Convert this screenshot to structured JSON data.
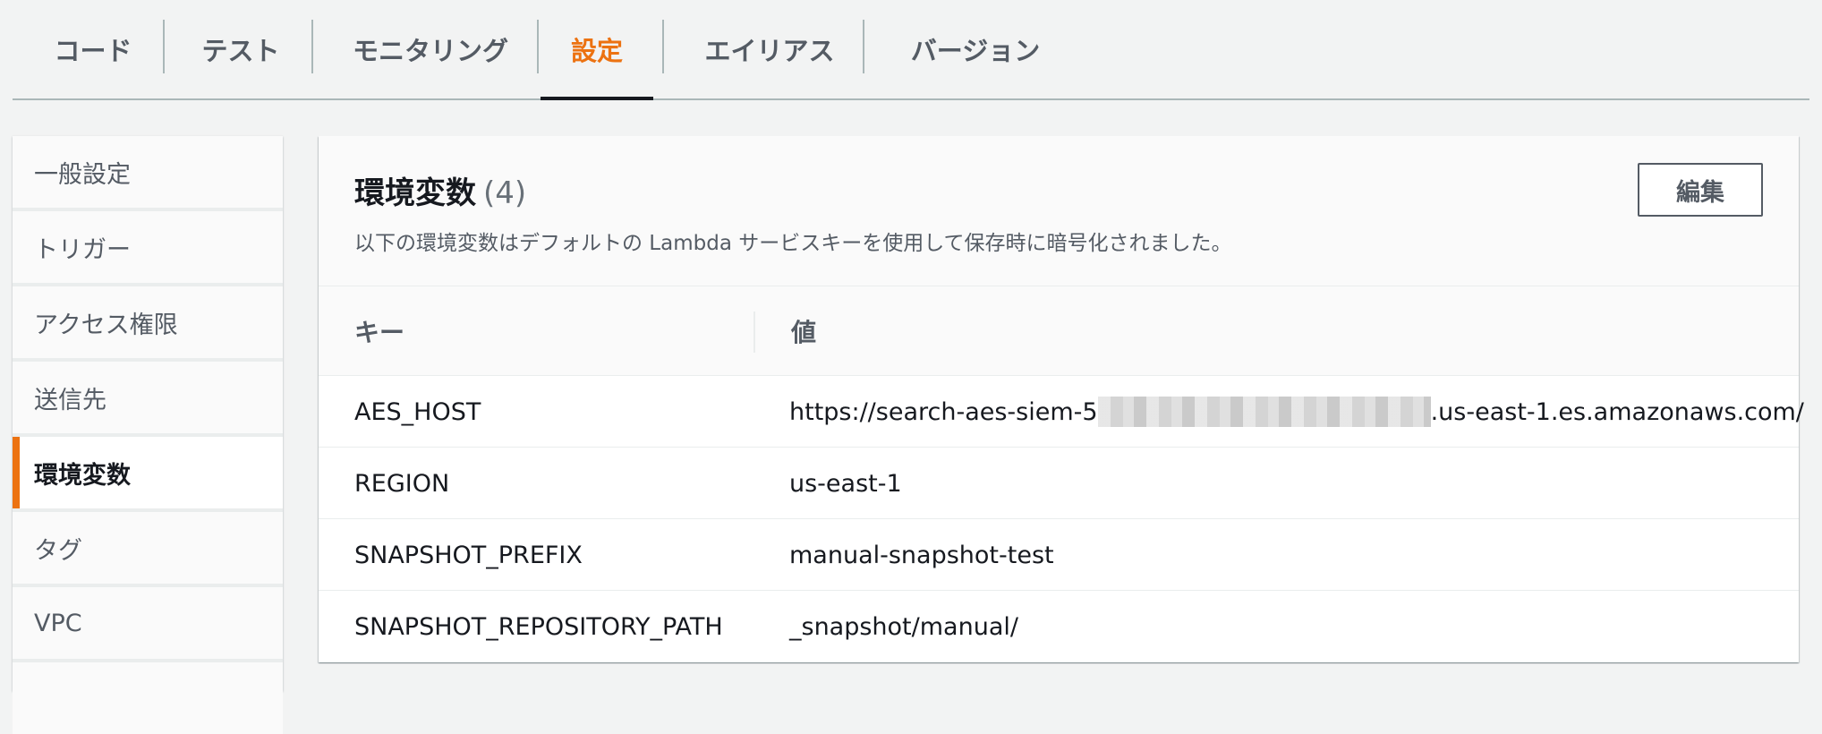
{
  "tabs": [
    {
      "label": "コード"
    },
    {
      "label": "テスト"
    },
    {
      "label": "モニタリング"
    },
    {
      "label": "設定"
    },
    {
      "label": "エイリアス"
    },
    {
      "label": "バージョン"
    }
  ],
  "sidebar": {
    "items": [
      {
        "label": "一般設定"
      },
      {
        "label": "トリガー"
      },
      {
        "label": "アクセス権限"
      },
      {
        "label": "送信先"
      },
      {
        "label": "環境変数"
      },
      {
        "label": "タグ"
      },
      {
        "label": "VPC"
      }
    ]
  },
  "panel": {
    "title": "環境変数",
    "count": "(4)",
    "description": "以下の環境変数はデフォルトの Lambda サービスキーを使用して保存時に暗号化されました。",
    "edit_label": "編集"
  },
  "table": {
    "headers": {
      "key": "キー",
      "value": "値"
    },
    "rows": [
      {
        "key": "AES_HOST",
        "value_prefix": "https://search-aes-siem-5",
        "value_suffix": ".us-east-1.es.amazonaws.com/"
      },
      {
        "key": "REGION",
        "value": "us-east-1"
      },
      {
        "key": "SNAPSHOT_PREFIX",
        "value": "manual-snapshot-test"
      },
      {
        "key": "SNAPSHOT_REPOSITORY_PATH",
        "value": "_snapshot/manual/"
      }
    ]
  },
  "colors": {
    "accent": "#ec7211",
    "text": "#16191f",
    "muted": "#545b64",
    "background": "#f2f3f3"
  }
}
